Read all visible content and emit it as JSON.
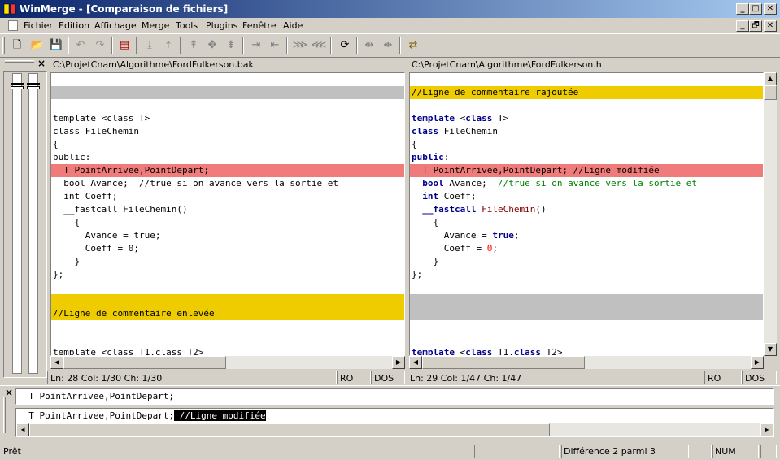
{
  "window": {
    "title": "WinMerge - [Comparaison de fichiers]",
    "minimize": "_",
    "maximize": "□",
    "close": "✕",
    "restore": "🗗"
  },
  "menu": [
    "Fichier",
    "Edition",
    "Affichage",
    "Merge",
    "Tools",
    "Plugins",
    "Fenêtre",
    "Aide"
  ],
  "toolbar": {
    "icons": [
      "new-icon",
      "open-icon",
      "save-icon",
      "undo-icon",
      "redo-icon",
      "options-icon",
      "next-diff-icon",
      "prev-diff-icon",
      "first-diff-icon",
      "current-diff-icon",
      "last-diff-icon",
      "copy-right-icon",
      "copy-left-icon",
      "all-right-icon",
      "all-left-icon",
      "refresh-icon",
      "zoom-icon",
      "merge-icon",
      "swap-icon"
    ]
  },
  "left": {
    "path": "C:\\ProjetCnam\\Algorithme\\FordFulkerson.bak",
    "status": {
      "pos": "Ln: 28  Col: 1/30  Ch: 1/30",
      "ro": "RO",
      "eol": "DOS"
    }
  },
  "right": {
    "path": "C:\\ProjetCnam\\Algorithme\\FordFulkerson.h",
    "status": {
      "pos": "Ln: 29  Col: 1/47  Ch: 1/47",
      "ro": "RO",
      "eol": "DOS"
    }
  },
  "code_left": [
    "",
    "template <class T>",
    "class FileChemin",
    "{",
    "public:",
    "  T PointArrivee,PointDepart;",
    "  bool Avance;  //true si on avance vers la sortie et",
    "  int Coeff;",
    "  __fastcall FileChemin()",
    "    {",
    "      Avance = true;",
    "      Coeff = 0;",
    "    }",
    "};",
    "",
    "//Ligne de commentaire enlevée",
    "",
    "",
    "template <class T1,class T2>"
  ],
  "code_right_comment": "//Ligne de commentaire rajoutée",
  "code_right_modified": "  T PointArrivee,PointDepart; //Ligne modifiée",
  "detail": {
    "top_line": "  T PointArrivee,PointDepart;",
    "bottom_line_start": "  T PointArrivee,PointDepart;",
    "bottom_line_highlight": " //Ligne modifiée"
  },
  "statusbar": {
    "ready": "Prêt",
    "diff": "Différence 2 parmi 3",
    "num": "NUM"
  },
  "close_glyph": "×",
  "colors": {
    "added": "#efcc00",
    "changed": "#ef7b7b",
    "blank": "#c0c0c0"
  }
}
